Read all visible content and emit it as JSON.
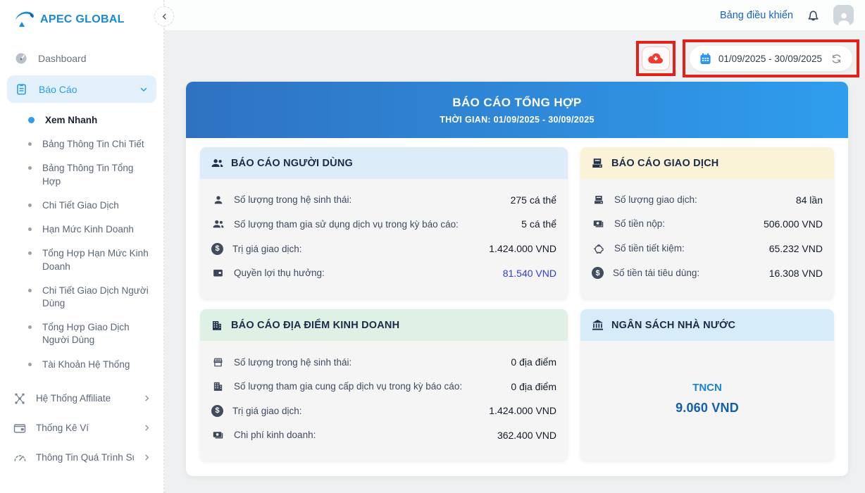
{
  "brand": {
    "name": "APEC GLOBAL"
  },
  "glyphs": {
    "dollar": "$"
  },
  "colors": {
    "accent_blue": "#2b9bf4",
    "banner_gradient_start": "#2f72c2",
    "banner_gradient_end": "#2f9ded",
    "annotation_red": "#e42119",
    "highlight_value_blue": "#2e3af2",
    "tncn_blue": "#1b83d8",
    "tncn_value_blue": "#115fae",
    "header_blue": "#dcedf9",
    "header_yellow": "#faf3d7",
    "header_green": "#dff0e4",
    "header_lightblue": "#d6ecf8"
  },
  "sidebar": {
    "items": {
      "dashboard": {
        "label": "Dashboard",
        "icon": "gauge-icon"
      },
      "bao_cao": {
        "label": "Báo Cáo",
        "icon": "clipboard-icon",
        "expanded": true
      }
    },
    "sub_items": [
      {
        "label": "Xem Nhanh",
        "active": true
      },
      {
        "label": "Bảng Thông Tin Chi Tiết"
      },
      {
        "label": "Bảng Thông Tin Tổng Hợp"
      },
      {
        "label": "Chi Tiết Giao Dịch"
      },
      {
        "label": "Hạn Mức Kinh Doanh"
      },
      {
        "label": "Tổng Hợp Hạn Mức Kinh Doanh"
      },
      {
        "label": "Chi Tiết Giao Dịch Người Dùng"
      },
      {
        "label": "Tổng Hợp Giao Dịch Người Dùng"
      },
      {
        "label": "Tài Khoản Hệ Thống"
      }
    ],
    "groups": [
      {
        "label": "Hệ Thống Affiliate",
        "icon": "network-icon"
      },
      {
        "label": "Thống Kê Ví",
        "icon": "wallet-icon"
      },
      {
        "label": "Thông Tin Quá Trình Sử",
        "icon": "speedometer-icon"
      }
    ]
  },
  "topbar": {
    "dashboard_link": "Bảng điều khiển"
  },
  "controls": {
    "date_range": "01/09/2025 - 30/09/2025"
  },
  "banner": {
    "title": "BÁO CÁO TỔNG HỢP",
    "subtitle": "THỜI GIAN: 01/09/2025 - 30/09/2025"
  },
  "cards": [
    {
      "title": "BÁO CÁO NGƯỜI DÙNG",
      "icon": "people-icon",
      "rows": [
        {
          "icon": "person-icon",
          "label": "Số lượng trong hệ sinh thái:",
          "value": "275 cá thể"
        },
        {
          "icon": "people-icon",
          "label": "Số lượng tham gia sử dụng dịch vụ trong kỳ báo cáo:",
          "value": "5 cá thể"
        },
        {
          "icon": "dollar-circle-icon",
          "label": "Trị giá giao dịch:",
          "value": "1.424.000 VND"
        },
        {
          "icon": "wallet-card-icon",
          "label": "Quyền lợi thụ hưởng:",
          "value": "81.540 VND",
          "highlight": true
        }
      ]
    },
    {
      "title": "BÁO CÁO GIAO DỊCH",
      "icon": "receipt-icon",
      "rows": [
        {
          "icon": "receipt-icon",
          "label": "Số lượng giao dịch:",
          "value": "84 lần"
        },
        {
          "icon": "banknote-icon",
          "label": "Số tiền nộp:",
          "value": "506.000 VND"
        },
        {
          "icon": "piggy-bank-icon",
          "label": "Số tiền tiết kiệm:",
          "value": "65.232 VND"
        },
        {
          "icon": "dollar-circle-icon",
          "label": "Số tiền tái tiêu dùng:",
          "value": "16.308 VND"
        }
      ]
    },
    {
      "title": "BÁO CÁO ĐỊA ĐIỂM KINH DOANH",
      "icon": "building-icon",
      "rows": [
        {
          "icon": "storefront-icon",
          "label": "Số lượng trong hệ sinh thái:",
          "value": "0 địa điểm"
        },
        {
          "icon": "building-icon",
          "label": "Số lượng tham gia cung cấp dịch vụ trong kỳ báo cáo:",
          "value": "0 địa điểm"
        },
        {
          "icon": "dollar-circle-icon",
          "label": "Trị giá giao dịch:",
          "value": "1.424.000 VND"
        },
        {
          "icon": "banknote-icon",
          "label": "Chi phí kinh doanh:",
          "value": "362.400 VND"
        }
      ]
    },
    {
      "title": "NGÂN SÁCH NHÀ NƯỚC",
      "icon": "bank-icon",
      "center": {
        "label": "TNCN",
        "value": "9.060 VND"
      }
    }
  ]
}
